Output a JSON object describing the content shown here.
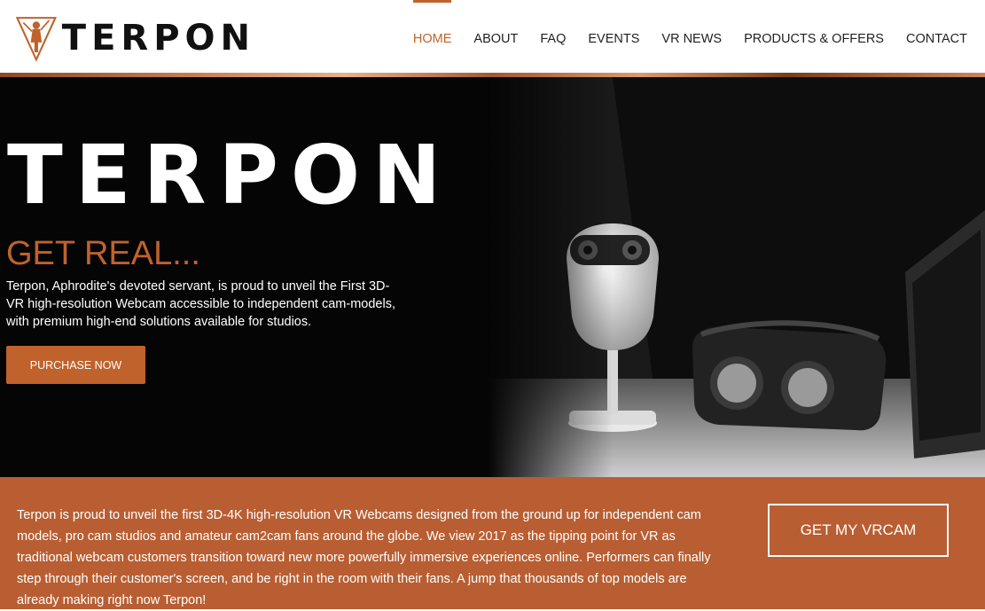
{
  "header": {
    "logo_text": "TERPON",
    "nav": [
      {
        "label": "HOME",
        "active": true
      },
      {
        "label": "ABOUT",
        "active": false
      },
      {
        "label": "FAQ",
        "active": false
      },
      {
        "label": "EVENTS",
        "active": false
      },
      {
        "label": "VR NEWS",
        "active": false
      },
      {
        "label": "PRODUCTS & OFFERS",
        "active": false
      },
      {
        "label": "CONTACT",
        "active": false
      }
    ]
  },
  "hero": {
    "brand": "TERPON",
    "tagline": "GET REAL...",
    "description": "Terpon, Aphrodite's devoted servant, is proud to unveil the First 3D-VR high-resolution Webcam accessible to independent cam-models, with premium high-end solutions available for studios.",
    "cta_label": "PURCHASE NOW",
    "image_icon": "vr-webcam-and-headset-photo"
  },
  "band": {
    "text": "Terpon is proud to unveil the first 3D-4K high-resolution VR Webcams designed from the ground up for independent cam models, pro cam studios and amateur cam2cam fans around the globe. We view 2017 as the tipping point for VR as traditional webcam customers transition toward new more powerfully immersive experiences online. Performers can finally step through their customer's screen, and be right in the room with their fans. A jump that thousands of top models are already making right now Terpon!",
    "cta_label": "GET MY VRCAM"
  },
  "colors": {
    "accent": "#c0622c",
    "band": "#b85e32",
    "hero_bg": "#050505"
  }
}
